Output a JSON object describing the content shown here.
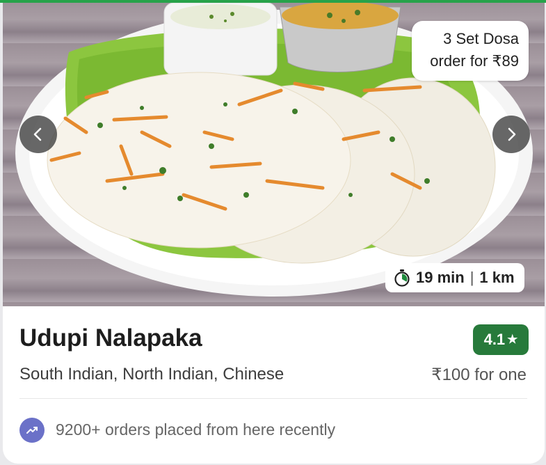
{
  "offer": {
    "line1": "3 Set Dosa",
    "line2": "order for ₹89"
  },
  "eta": {
    "time": "19 min",
    "separator": "|",
    "distance": "1 km"
  },
  "restaurant": {
    "name": "Udupi Nalapaka",
    "rating": "4.1",
    "rating_color": "#277a3b",
    "cuisines": "South Indian, North Indian, Chinese",
    "price": "₹100 for one"
  },
  "footer": {
    "orders_text": "9200+ orders placed from here recently",
    "icon_color": "#6b71c8"
  },
  "icons": {
    "prev": "chevron-left-icon",
    "next": "chevron-right-icon",
    "timer": "timer-icon",
    "trend": "trending-up-icon"
  }
}
